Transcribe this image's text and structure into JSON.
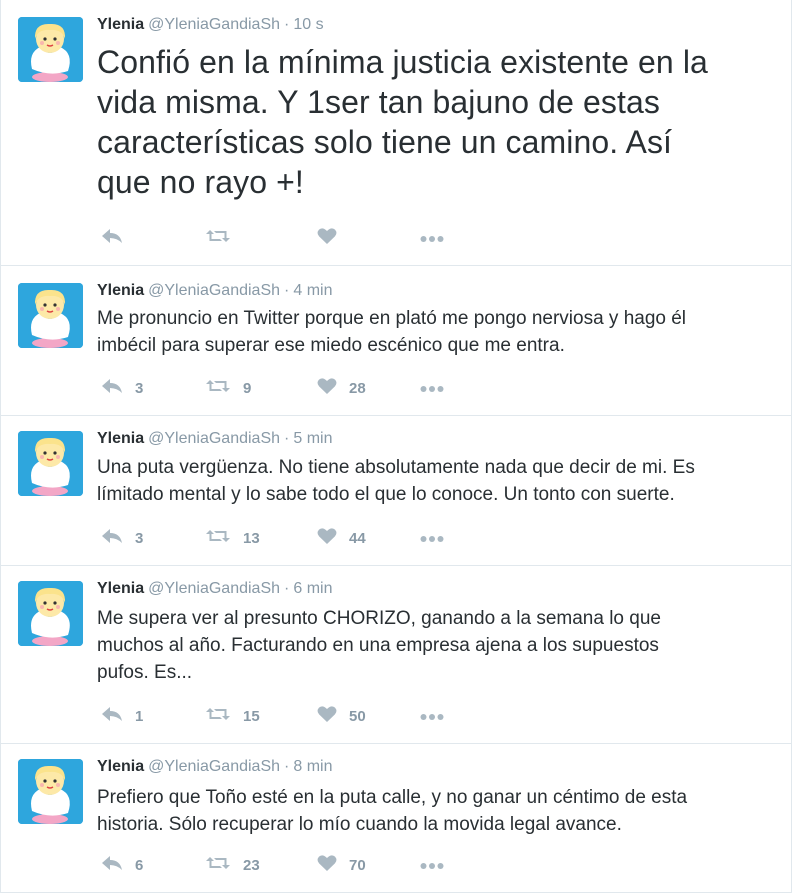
{
  "tweets": [
    {
      "name": "Ylenia",
      "handle": "@YleniaGandiaSh",
      "separator": "·",
      "time": "10 s",
      "text": "Confió en la mínima justicia existente en la\nvida misma. Y 1ser tan bajuno de estas\ncaracterísticas solo tiene un camino. Así\nque no rayo +!",
      "reply_count": "",
      "retweet_count": "",
      "like_count": ""
    },
    {
      "name": "Ylenia",
      "handle": "@YleniaGandiaSh",
      "separator": "·",
      "time": "4 min",
      "text": "Me pronuncio en Twitter porque en plató me pongo nerviosa y hago él\nimbécil para superar ese miedo escénico que me entra.",
      "reply_count": "3",
      "retweet_count": "9",
      "like_count": "28"
    },
    {
      "name": "Ylenia",
      "handle": "@YleniaGandiaSh",
      "separator": "·",
      "time": "5 min",
      "text": "Una puta vergüenza. No tiene absolutamente nada que decir de mi. Es\nlímitado mental y lo sabe todo el que lo conoce. Un tonto con suerte.",
      "reply_count": "3",
      "retweet_count": "13",
      "like_count": "44"
    },
    {
      "name": "Ylenia",
      "handle": "@YleniaGandiaSh",
      "separator": "·",
      "time": "6 min",
      "text": "Me supera ver al presunto CHORIZO, ganando a la semana lo que\nmuchos al año. Facturando en una empresa ajena a los supuestos\npufos. Es...",
      "reply_count": "1",
      "retweet_count": "15",
      "like_count": "50"
    },
    {
      "name": "Ylenia",
      "handle": "@YleniaGandiaSh",
      "separator": "·",
      "time": "8 min",
      "text": "Prefiero que Toño esté en la puta calle, y no ganar un céntimo de esta\nhistoria. Sólo recuperar lo mío cuando la movida legal avance.",
      "reply_count": "6",
      "retweet_count": "23",
      "like_count": "70"
    }
  ],
  "icons": {
    "reply": "reply-icon",
    "retweet": "retweet-icon",
    "like": "heart-icon",
    "more": "more-dots-icon"
  },
  "colors": {
    "avatar_bg": "#2ea6dd",
    "text": "#292f33",
    "muted": "#8899a6",
    "icon": "#aab8c2",
    "border": "#e1e8ed"
  }
}
